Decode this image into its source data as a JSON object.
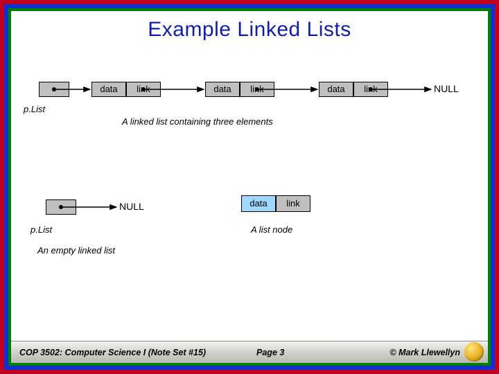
{
  "title": "Example Linked Lists",
  "list1": {
    "plist_label": "p.List",
    "nodes": [
      {
        "data": "data",
        "link": "link"
      },
      {
        "data": "data",
        "link": "link"
      },
      {
        "data": "data",
        "link": "link"
      }
    ],
    "terminal": "NULL",
    "caption": "A linked list containing three elements"
  },
  "list2": {
    "plist_label": "p.List",
    "terminal": "NULL",
    "caption": "An empty linked list"
  },
  "node_example": {
    "data": "data",
    "link": "link",
    "caption": "A list node"
  },
  "footer": {
    "course": "COP 3502: Computer Science I  (Note Set #15)",
    "page": "Page 3",
    "copyright": "© Mark Llewellyn"
  }
}
